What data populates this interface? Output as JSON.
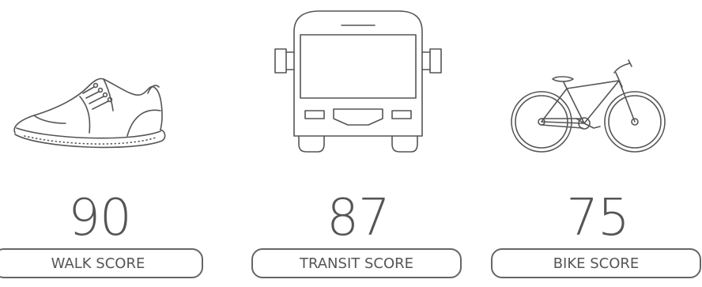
{
  "scores": [
    {
      "id": "walk",
      "value": "90",
      "label": "WALK SCORE",
      "icon": "shoe-icon"
    },
    {
      "id": "transit",
      "value": "87",
      "label": "TRANSIT SCORE",
      "icon": "bus-icon"
    },
    {
      "id": "bike",
      "value": "75",
      "label": "BIKE SCORE",
      "icon": "bicycle-icon"
    }
  ],
  "colors": {
    "text": "#555555",
    "stroke": "#555555",
    "pill_border": "#666666",
    "background": "#ffffff"
  }
}
